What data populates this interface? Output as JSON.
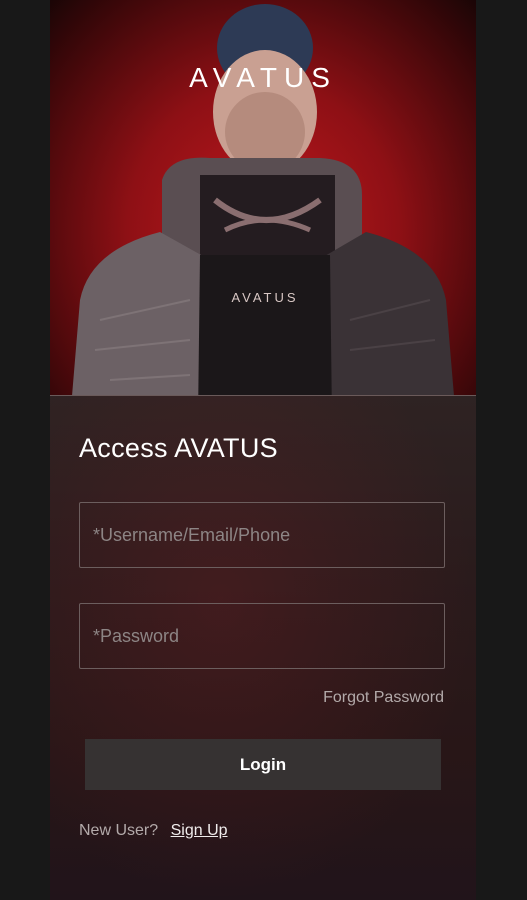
{
  "hero": {
    "logo": "AVATUS",
    "jacket_logo": "AVATUS"
  },
  "form": {
    "title": "Access AVATUS",
    "username_placeholder": "*Username/Email/Phone",
    "password_placeholder": "*Password",
    "forgot_label": "Forgot Password",
    "login_label": "Login",
    "new_user_label": "New User?",
    "signup_label": "Sign Up"
  },
  "colors": {
    "hero_red": "#c0181d",
    "card_bg": "#2a1b1c",
    "button_bg": "#363232"
  }
}
